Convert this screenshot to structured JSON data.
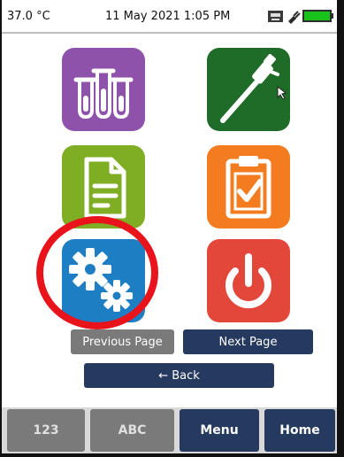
{
  "status": {
    "temperature": "37.0 °C",
    "datetime": "11 May 2021 1:05 PM",
    "icons": [
      "printer-icon",
      "plug-icon",
      "battery-icon"
    ]
  },
  "tiles": {
    "samples": {
      "icon": "test-tubes-icon",
      "color": "#8e52ab"
    },
    "pipette": {
      "icon": "pipette-icon",
      "color": "#1f6b28"
    },
    "document": {
      "icon": "document-icon",
      "color": "#7fae24"
    },
    "checklist": {
      "icon": "clipboard-check-icon",
      "color": "#f27c1f"
    },
    "settings": {
      "icon": "gears-icon",
      "color": "#1e7ec3"
    },
    "power": {
      "icon": "power-icon",
      "color": "#e2473a"
    }
  },
  "highlight": {
    "target": "settings",
    "color": "#e8131b"
  },
  "navigation": {
    "previous_label": "Previous Page",
    "next_label": "Next Page",
    "back_label": "← Back"
  },
  "bottom_bar": {
    "numeric_label": "123",
    "alpha_label": "ABC",
    "menu_label": "Menu",
    "home_label": "Home"
  },
  "colors": {
    "primary_button": "#253a5e",
    "disabled_button": "#7a7a7a",
    "battery": "#18c21a"
  }
}
